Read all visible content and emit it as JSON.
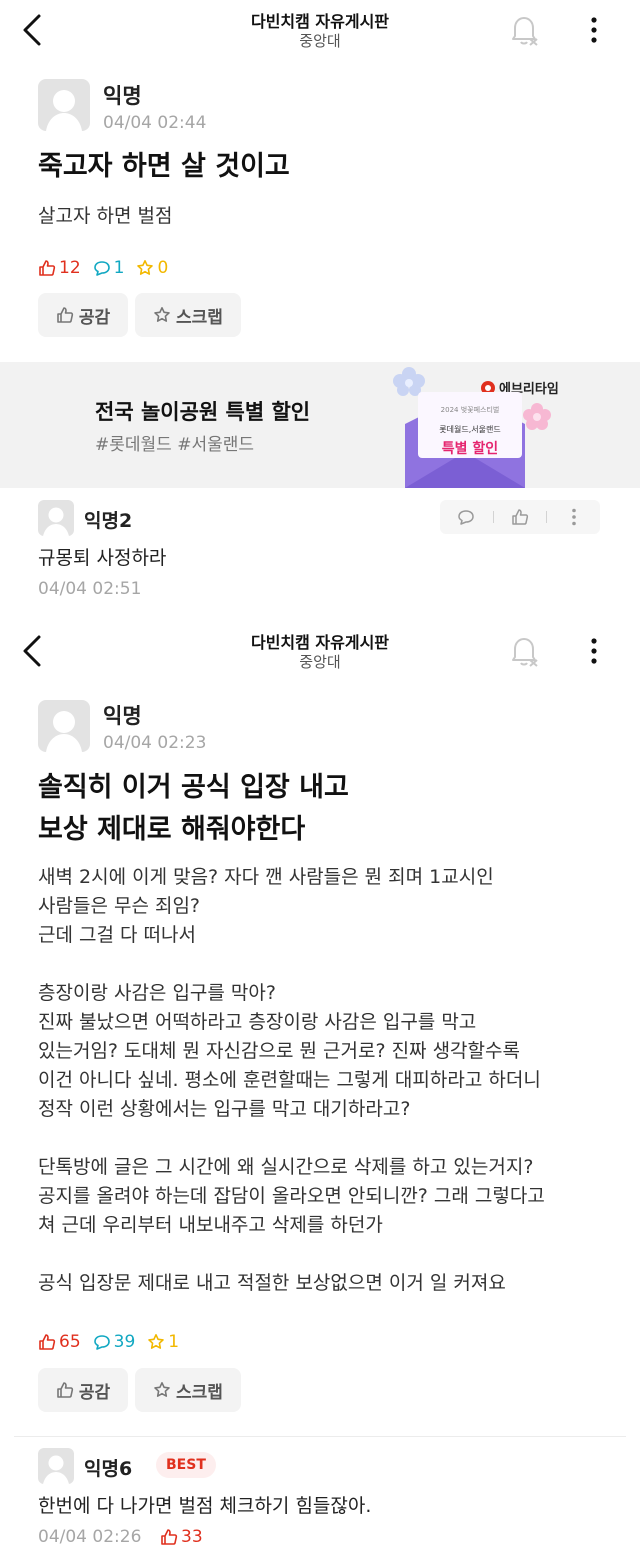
{
  "screen1": {
    "header": {
      "title": "다빈치캠 자유게시판",
      "subtitle": "중앙대"
    },
    "post": {
      "author": "익명",
      "date": "04/04 02:44",
      "title": "죽고자 하면 살 것이고",
      "body": "살고자 하면 벌점",
      "likes": "12",
      "comments": "1",
      "scraps": "0",
      "like_button": "공감",
      "scrap_button": "스크랩"
    },
    "ad": {
      "headline": "전국 놀이공원 특별 할인",
      "tags": "#롯데월드 #서울랜드",
      "brand": "에브리타임",
      "badge_year": "2024 벚꽃페스티벌",
      "badge_line1": "롯데월드,서울랜드",
      "badge_line2": "특별 할인"
    },
    "comment": {
      "author": "익명2",
      "text": "규몽퇴 사정하라",
      "date": "04/04 02:51"
    }
  },
  "screen2": {
    "header": {
      "title": "다빈치캠 자유게시판",
      "subtitle": "중앙대"
    },
    "post": {
      "author": "익명",
      "date": "04/04 02:23",
      "title_line1": "솔직히 이거 공식 입장 내고",
      "title_line2": "보상 제대로 해줘야한다",
      "body": "새벽 2시에 이게 맞음? 자다 깬 사람들은 뭔 죄며 1교시인\n사람들은 무슨 죄임?\n근데 그걸 다 떠나서\n\n층장이랑 사감은 입구를 막아?\n진짜 불났으면 어떡하라고 층장이랑 사감은 입구를 막고\n있는거임? 도대체 뭔 자신감으로 뭔 근거로? 진짜 생각할수록\n이건 아니다 싶네. 평소에 훈련할때는 그렇게 대피하라고 하더니\n정작 이런 상황에서는 입구를 막고 대기하라고?\n\n단톡방에 글은 그 시간에 왜 실시간으로 삭제를 하고 있는거지?\n공지를 올려야 하는데 잡담이 올라오면 안되니깐? 그래 그렇다고\n쳐 근데 우리부터 내보내주고 삭제를 하던가\n\n공식 입장문 제대로 내고 적절한 보상없으면 이거 일 커져요",
      "likes": "65",
      "comments": "39",
      "scraps": "1",
      "like_button": "공감",
      "scrap_button": "스크랩"
    },
    "comment": {
      "author": "익명6",
      "badge": "BEST",
      "text": "한번에 다 나가면 벌점 체크하기 힘들잖아.",
      "date": "04/04 02:26",
      "likes": "33"
    }
  },
  "colors": {
    "like": "#e0301e",
    "comment": "#12a8c2",
    "scrap": "#f2b800",
    "date": "#a6a6a6"
  },
  "icons": [
    "back-arrow-icon",
    "bell-off-icon",
    "more-vertical-icon",
    "thumbs-up-icon",
    "comment-bubble-icon",
    "star-icon"
  ]
}
